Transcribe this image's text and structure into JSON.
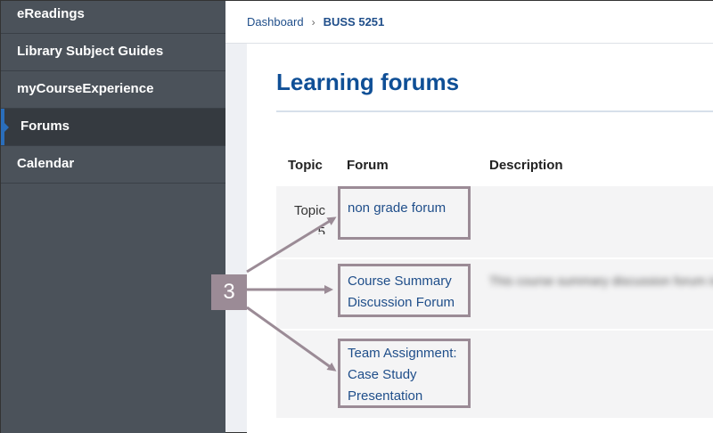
{
  "sidebar": {
    "items": [
      {
        "label": "eReadings",
        "active": false
      },
      {
        "label": "Library Subject Guides",
        "active": false
      },
      {
        "label": "myCourseExperience",
        "active": false
      },
      {
        "label": "Forums",
        "active": true
      },
      {
        "label": "Calendar",
        "active": false
      }
    ]
  },
  "breadcrumb": {
    "home": "Dashboard",
    "separator": "›",
    "current": "BUSS 5251"
  },
  "page": {
    "title": "Learning forums"
  },
  "table": {
    "headers": {
      "topic": "Topic",
      "forum": "Forum",
      "description": "Description"
    },
    "rows": [
      {
        "topic": "Topic 5",
        "forum_lines": [
          "non grade forum"
        ],
        "description": ""
      },
      {
        "topic": "",
        "forum_lines": [
          "Course Summary",
          "Discussion Forum"
        ],
        "description": "This course summary discussion forum is for students a forum to ask questions as a forum"
      },
      {
        "topic": "",
        "forum_lines": [
          "Team Assignment:",
          "Case Study",
          "Presentation"
        ],
        "description": ""
      }
    ]
  },
  "callout": {
    "number": "3",
    "color": "#9b8b96"
  },
  "colors": {
    "sidebar": "#4b525a",
    "sidebar_active": "#353a40",
    "accent": "#2a6ebb",
    "title": "#0f4f96",
    "link": "#1f4e8a"
  }
}
